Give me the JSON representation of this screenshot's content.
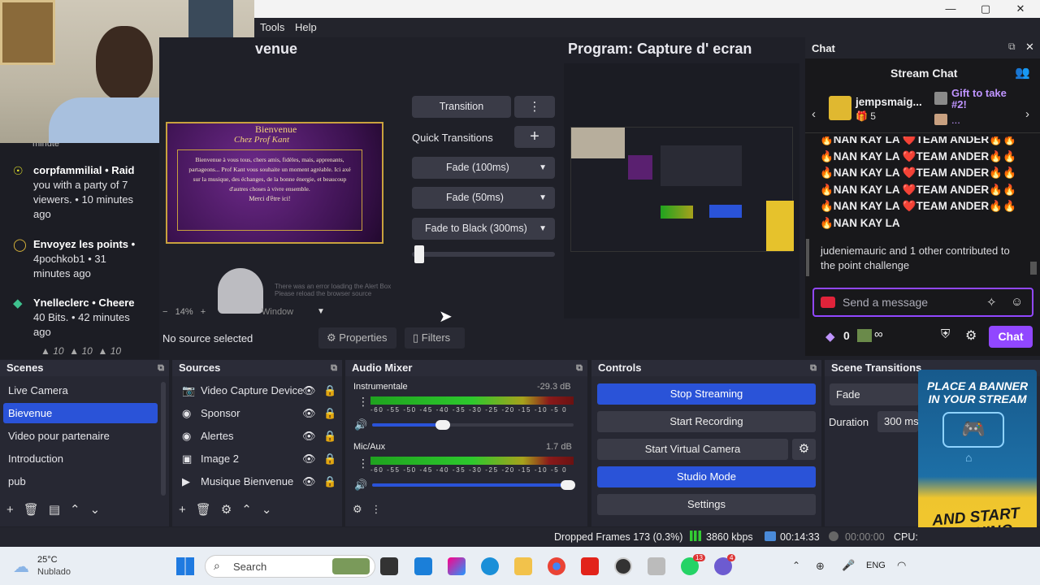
{
  "window": {
    "minimize": "—",
    "maximize": "▢",
    "close": "✕"
  },
  "menu": {
    "tools": "Tools",
    "help": "Help"
  },
  "preview": {
    "title_partial": "venue",
    "card_title": "Bienvenue",
    "card_subtitle": "Chez Prof Kant",
    "card_body": "Bienvenue à vous tous, chers amis, fidèles, mais, apprenants, partageons... Prof Kant vous souhaite un moment agréable. Ici axé sur la musique, des échanges, de la bonne énergie, et beaucoup d'autres choses à vivre ensemble.",
    "card_footer": "Merci d'être ici!",
    "browser_error_1": "There was an error loading the Alert Box",
    "browser_error_2": "Please reload the browser source",
    "zoom": "14%",
    "window_label": "Window"
  },
  "program": {
    "title": "Program: Capture d' ecran"
  },
  "transitions": {
    "transition_btn": "Transition",
    "quick_transitions": "Quick Transitions",
    "options": [
      "Fade (100ms)",
      "Fade (50ms)",
      "Fade to Black (300ms)"
    ],
    "tbar_level": 0.03
  },
  "source_toolbar": {
    "no_source": "No source selected",
    "properties": "Properties",
    "filters": "Filters"
  },
  "chat": {
    "title": "Chat",
    "stream_chat": "Stream Chat",
    "gifter_name": "jempsmaig...",
    "gifter_count": "5",
    "gift_text": "Gift to take #2!",
    "gift_more": "...",
    "messages": [
      "🔥NAN KAY LA ❤️TEAM ANDER🔥🔥",
      "🔥NAN KAY LA ❤️TEAM ANDER🔥🔥",
      "🔥NAN KAY LA ❤️TEAM ANDER🔥🔥",
      "🔥NAN KAY LA ❤️TEAM ANDER🔥🔥",
      "🔥NAN KAY LA ❤️TEAM ANDER🔥🔥",
      "🔥NAN KAY LA"
    ],
    "contribution": "judeniemauric and 1 other contributed to the point challenge",
    "placeholder": "Send a message",
    "points": "0",
    "infinity": "∞",
    "chat_button": "Chat"
  },
  "activity": [
    {
      "name": "",
      "text": "minute"
    },
    {
      "name": "corpfammilial • Raid",
      "text": "you with a party of 7 viewers. • 10 minutes ago"
    },
    {
      "name": "Envoyez les points •",
      "text": "4pochkob1 • 31 minutes ago"
    },
    {
      "name": "Ynelleclerc • Cheere",
      "text": "40 Bits. • 42 minutes ago"
    }
  ],
  "activity_bottom": [
    "10",
    "10",
    "10"
  ],
  "scenes": {
    "title": "Scenes",
    "items": [
      "Live Camera",
      "Bievenue",
      "Video pour partenaire",
      "Introduction",
      "pub"
    ],
    "selected_index": 1
  },
  "sources": {
    "title": "Sources",
    "items": [
      "Video Capture Device",
      "Sponsor",
      "Alertes",
      "Image 2",
      "Musique Bienvenue"
    ]
  },
  "mixer": {
    "title": "Audio Mixer",
    "channels": [
      {
        "name": "Instrumentale",
        "db": "-29.3 dB",
        "volume": 0.38
      },
      {
        "name": "Mic/Aux",
        "db": "1.7 dB",
        "volume": 1.0
      }
    ],
    "scale": "-60 -55 -50 -45 -40 -35 -30 -25 -20 -15 -10 -5 0"
  },
  "controls": {
    "title": "Controls",
    "stop_streaming": "Stop Streaming",
    "start_recording": "Start Recording",
    "start_virtual_camera": "Start Virtual Camera",
    "studio_mode": "Studio Mode",
    "settings": "Settings"
  },
  "scene_transitions": {
    "title": "Scene Transitions",
    "type": "Fade",
    "duration_label": "Duration",
    "duration": "300 ms"
  },
  "ad": {
    "line1": "PLACE A BANNER IN YOUR STREAM",
    "line2": "AND START EARNING TODAY!"
  },
  "status": {
    "dropped": "Dropped Frames 173 (0.3%)",
    "bitrate": "3860 kbps",
    "stream_time": "00:14:33",
    "rec_time": "00:00:00",
    "cpu": "CPU:"
  },
  "taskbar": {
    "temp": "25°C",
    "weather": "Nublado",
    "search": "Search",
    "lang": "ENG",
    "badge1": "13",
    "badge2": "4"
  },
  "colors": {
    "accent": "#2a53d8",
    "twitch": "#9147ff",
    "selected": "#2a53d8"
  }
}
